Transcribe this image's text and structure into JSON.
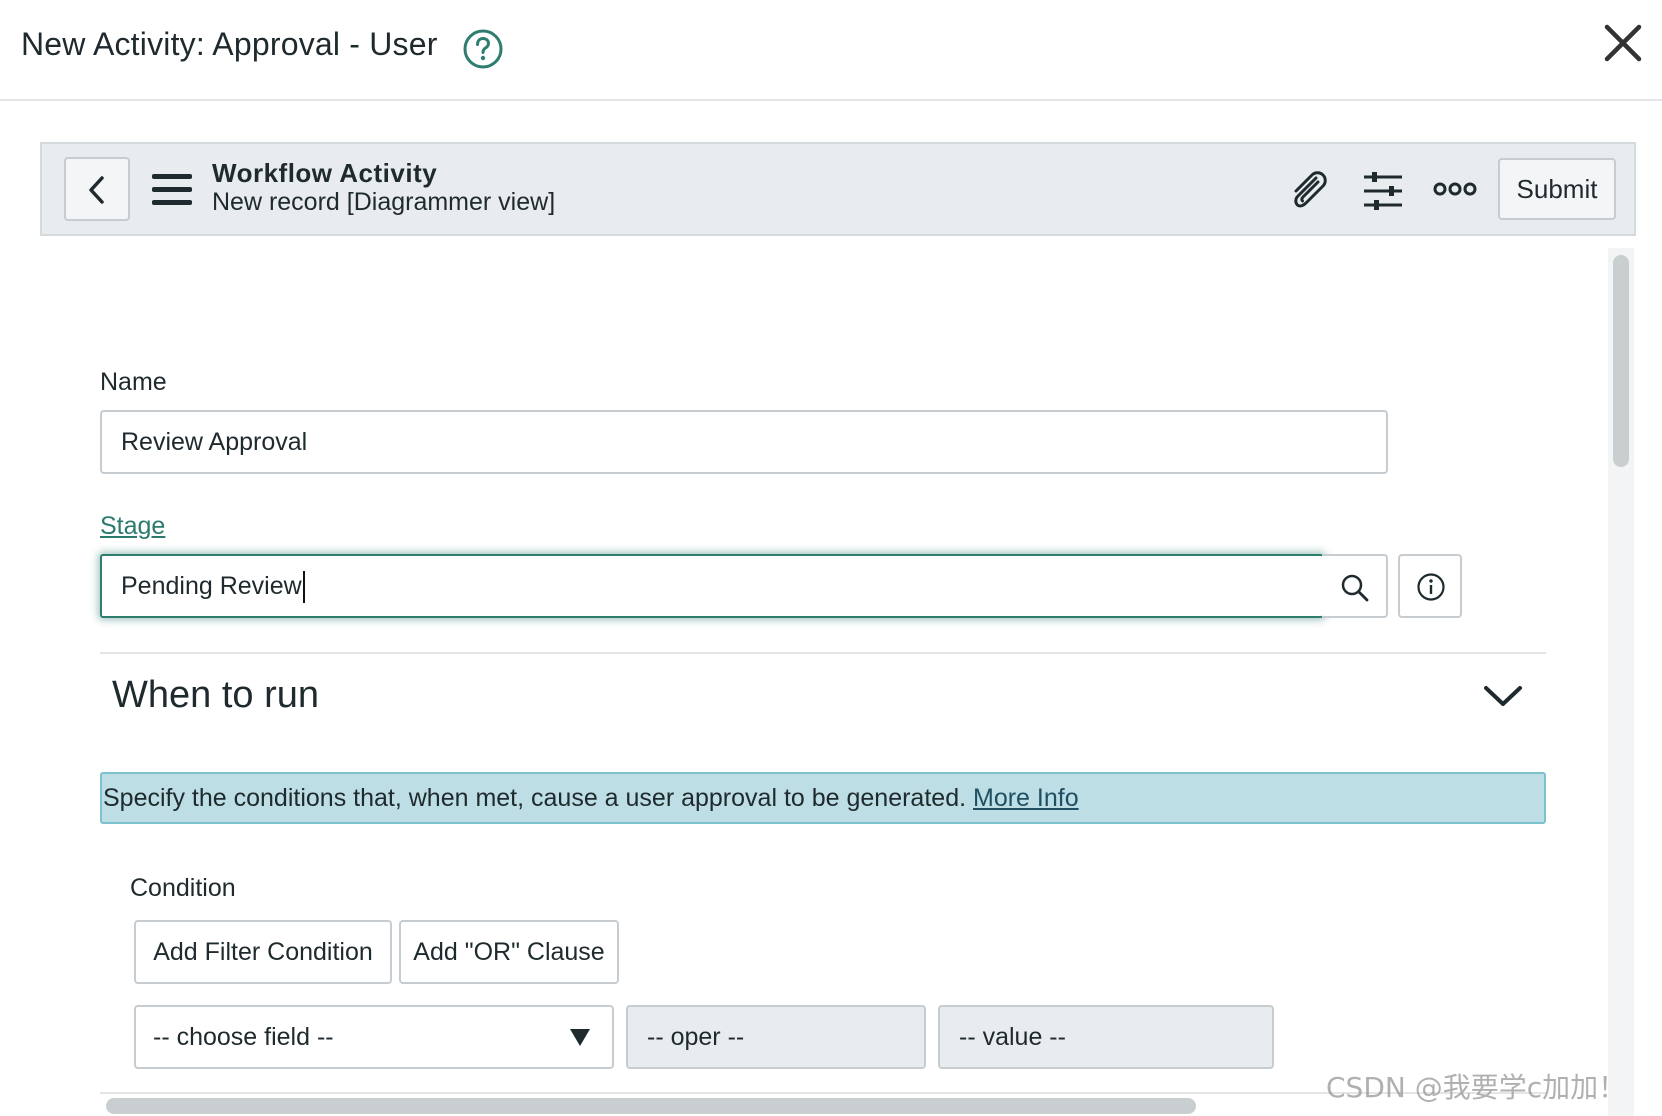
{
  "modal": {
    "title": "New Activity: Approval - User",
    "help_icon": "question-circle-icon",
    "close_icon": "close-x-icon"
  },
  "toolbar": {
    "title": "Workflow Activity",
    "subtitle": "New record [Diagrammer view]",
    "submit_label": "Submit",
    "icons": [
      "chevron-left-icon",
      "hamburger-menu-icon",
      "paperclip-icon",
      "sliders-icon",
      "more-dots-icon"
    ]
  },
  "form": {
    "name_label": "Name",
    "name_value": "Review Approval",
    "stage_label": "Stage",
    "stage_value": "Pending Review"
  },
  "when_to_run": {
    "title": "When to run",
    "info_text": "Specify the conditions that, when met, cause a user approval to be generated.",
    "more_info": "More Info",
    "condition_label": "Condition",
    "add_filter_label": "Add Filter Condition",
    "add_or_label": "Add \"OR\" Clause",
    "field_placeholder": "-- choose field --",
    "oper_placeholder": "-- oper --",
    "value_placeholder": "-- value --"
  },
  "watermark": "CSDN @我要学c加加！",
  "colors": {
    "accent_teal": "#2e7d6f",
    "info_banner_bg": "#bcdee4",
    "toolbar_bg": "#e9ecee"
  }
}
